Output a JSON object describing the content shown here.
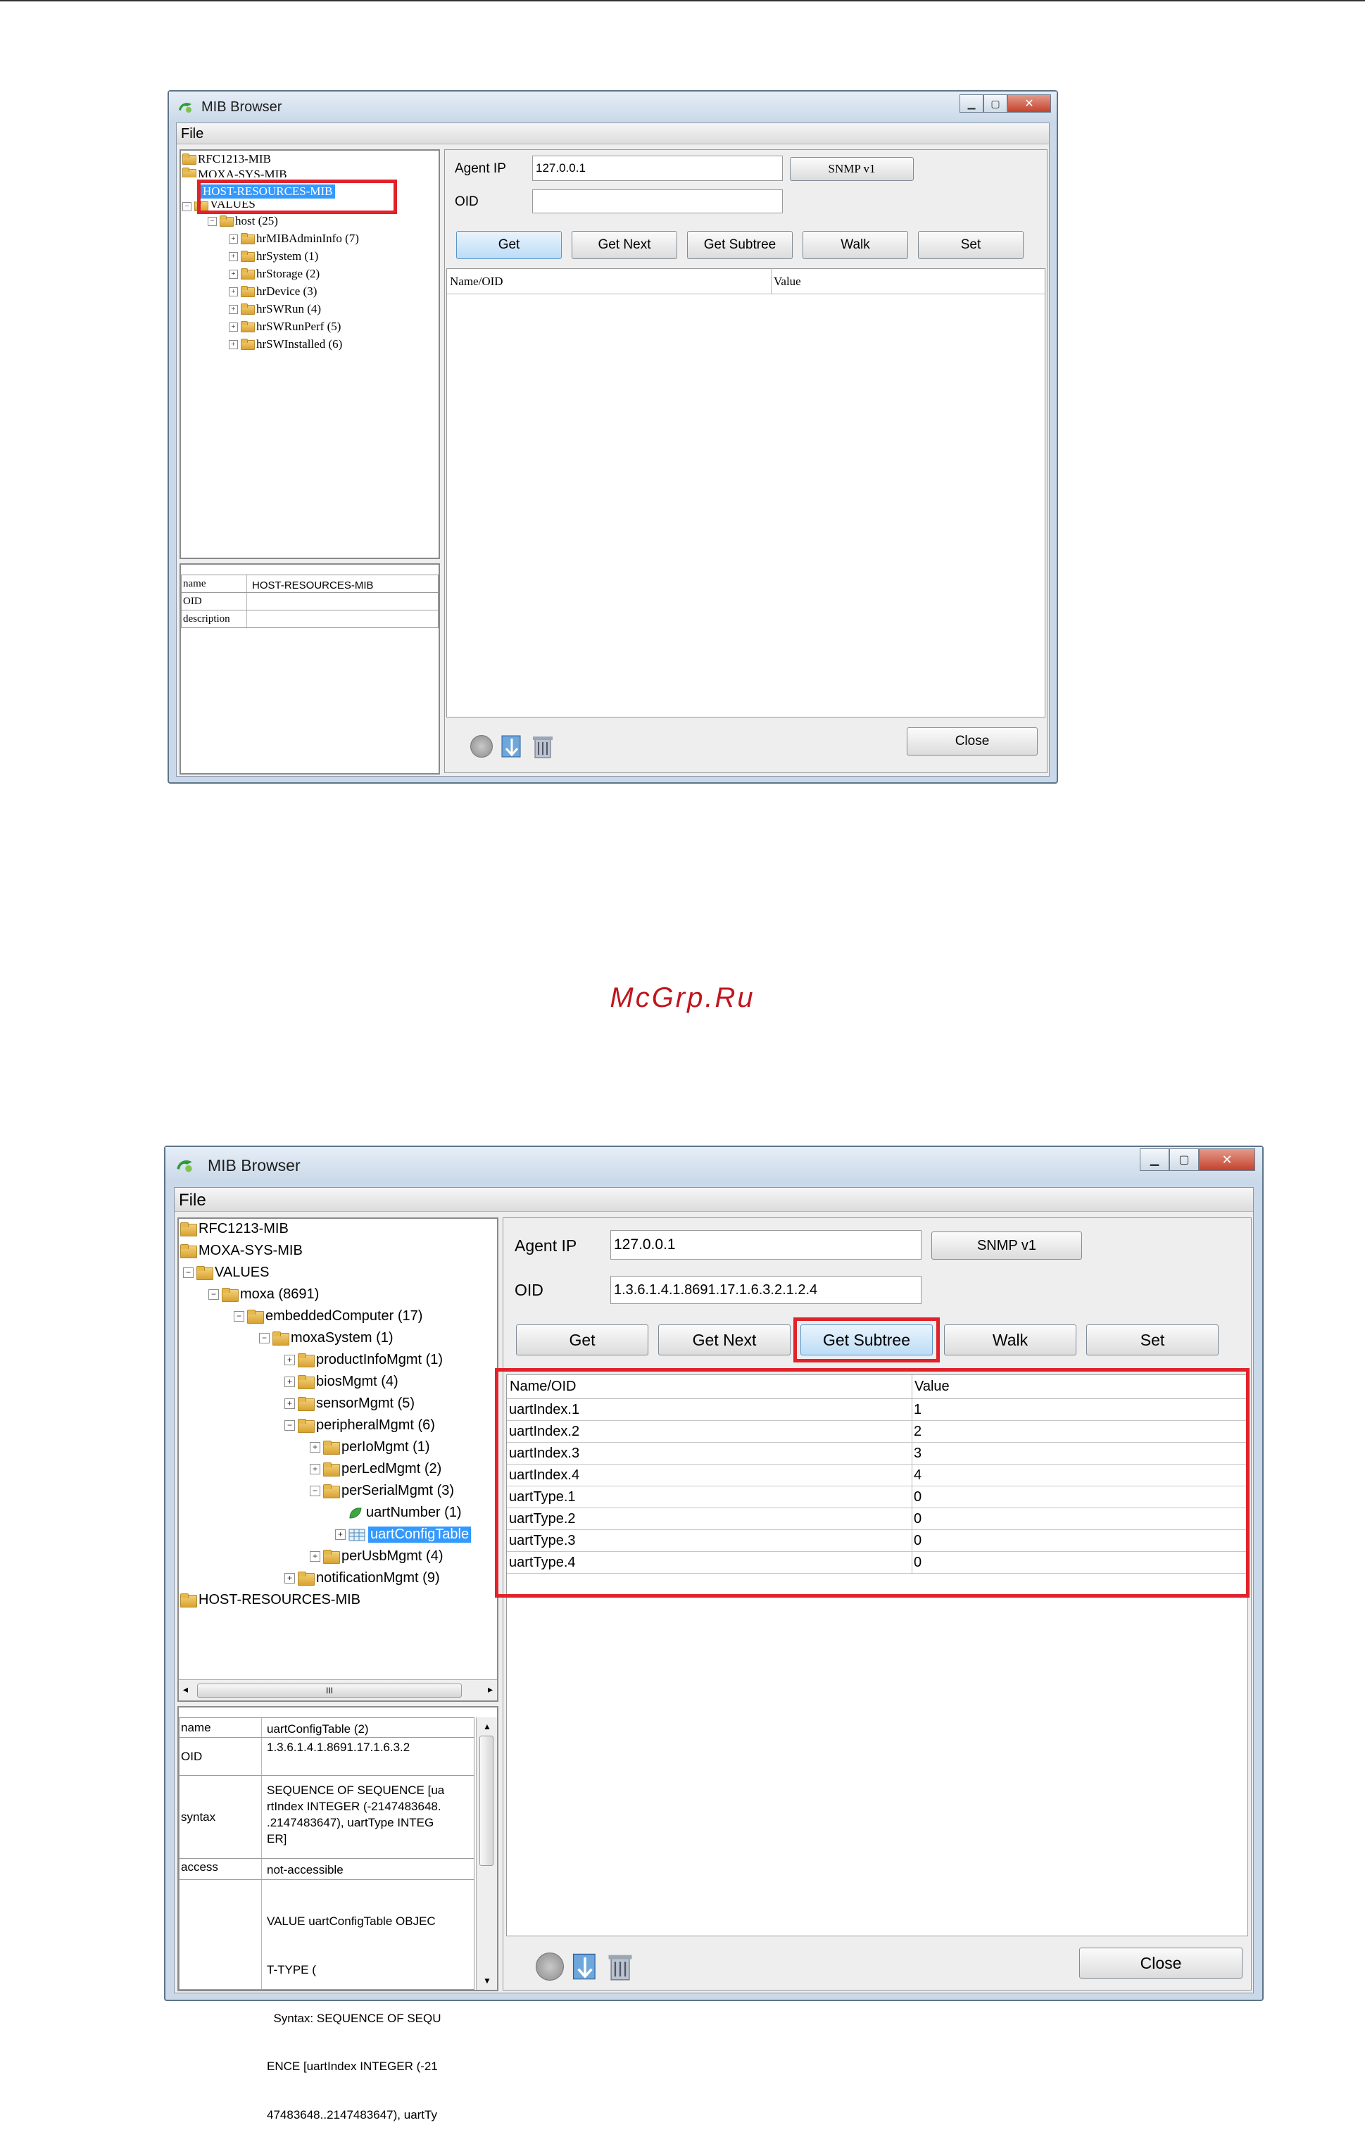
{
  "window1": {
    "title": "MIB Browser",
    "menu": "File",
    "tree": {
      "items": [
        "RFC1213-MIB",
        "MOXA-SYS-MIB",
        "HOST-RESOURCES-MIB",
        "VALUES"
      ],
      "host": "host (25)",
      "children": [
        "hrMIBAdminInfo (7)",
        "hrSystem (1)",
        "hrStorage (2)",
        "hrDevice (3)",
        "hrSWRun (4)",
        "hrSWRunPerf (5)",
        "hrSWInstalled (6)"
      ]
    },
    "properties": {
      "name_key": "name",
      "name_val": "HOST-RESOURCES-MIB",
      "oid_key": "OID",
      "desc_key": "description"
    },
    "agent_ip_label": "Agent IP",
    "agent_ip": "127.0.0.1",
    "snmp_button": "SNMP v1",
    "oid_label": "OID",
    "oid_value": "",
    "buttons": [
      "Get",
      "Get Next",
      "Get Subtree",
      "Walk",
      "Set"
    ],
    "columns": [
      "Name/OID",
      "Value"
    ],
    "close": "Close"
  },
  "watermark": "McGrp.Ru",
  "window2": {
    "title": "MIB Browser",
    "menu": "File",
    "tree": {
      "rfc": "RFC1213-MIB",
      "moxasys": "MOXA-SYS-MIB",
      "values": "VALUES",
      "moxa": "moxa (8691)",
      "embedded": "embeddedComputer (17)",
      "moxasystem": "moxaSystem (1)",
      "product": "productInfoMgmt (1)",
      "bios": "biosMgmt (4)",
      "sensor": "sensorMgmt (5)",
      "peripheral": "peripheralMgmt (6)",
      "perio": "perIoMgmt (1)",
      "perled": "perLedMgmt (2)",
      "perserial": "perSerialMgmt (3)",
      "uartnumber": "uartNumber (1)",
      "uartconfig": "uartConfigTable",
      "perusb": "perUsbMgmt (4)",
      "notification": "notificationMgmt (9)",
      "hostres": "HOST-RESOURCES-MIB"
    },
    "scroll_thumb": "III",
    "properties": {
      "name_key": "name",
      "name_val": "uartConfigTable (2)",
      "oid_key": "OID",
      "oid_val": "1.3.6.1.4.1.8691.17.1.6.3.2",
      "syntax_key": "syntax",
      "syntax_lines": [
        "SEQUENCE OF SEQUENCE [ua",
        "rtIndex INTEGER (-2147483648.",
        ".2147483647), uartType INTEG",
        "ER]"
      ],
      "access_key": "access",
      "access_val": "not-accessible",
      "value_lines": [
        "VALUE uartConfigTable OBJEC",
        "T-TYPE (",
        "  Syntax: SEQUENCE OF SEQU",
        "ENCE [uartIndex INTEGER (-21",
        "47483648..2147483647), uartTy"
      ]
    },
    "agent_ip_label": "Agent IP",
    "agent_ip": "127.0.0.1",
    "snmp_button": "SNMP v1",
    "oid_label": "OID",
    "oid_value": "1.3.6.1.4.1.8691.17.1.6.3.2.1.2.4",
    "buttons": [
      "Get",
      "Get Next",
      "Get Subtree",
      "Walk",
      "Set"
    ],
    "columns": [
      "Name/OID",
      "Value"
    ],
    "rows": [
      [
        "uartIndex.1",
        "1"
      ],
      [
        "uartIndex.2",
        "2"
      ],
      [
        "uartIndex.3",
        "3"
      ],
      [
        "uartIndex.4",
        "4"
      ],
      [
        "uartType.1",
        "0"
      ],
      [
        "uartType.2",
        "0"
      ],
      [
        "uartType.3",
        "0"
      ],
      [
        "uartType.4",
        "0"
      ]
    ],
    "close": "Close"
  }
}
